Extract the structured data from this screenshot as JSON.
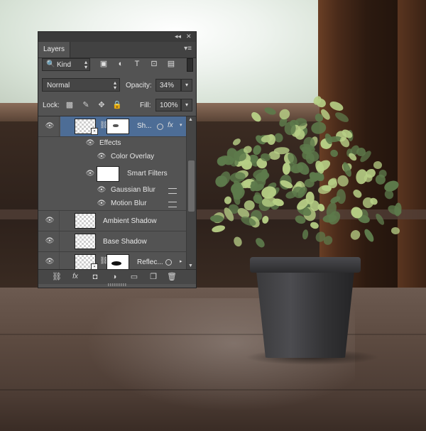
{
  "panel": {
    "tab_title": "Layers",
    "filter_kind": "Kind",
    "blend_mode": "Normal",
    "opacity_label": "Opacity:",
    "opacity_value": "34%",
    "lock_label": "Lock:",
    "fill_label": "Fill:",
    "fill_value": "100%"
  },
  "icons": {
    "search": "🔍",
    "image": "▣",
    "adjust": "◐",
    "type": "T",
    "transform": "⊡",
    "smart": "▤",
    "lock_pixels": "▩",
    "lock_paint": "✎",
    "lock_move": "✥",
    "lock_all": "🔒",
    "eye": "👁",
    "fx": "fx",
    "link": "⛓",
    "add_mask": "◘",
    "adjustment": "◑",
    "group": "▭",
    "new_layer": "❐",
    "trash": "🗑"
  },
  "layers": {
    "row1": {
      "name": "Sh...",
      "fx": "fx"
    },
    "effects_label": "Effects",
    "color_overlay": "Color Overlay",
    "smart_filters": "Smart Filters",
    "gaussian_blur": "Gaussian Blur",
    "motion_blur": "Motion Blur",
    "row_ambient": {
      "name": "Ambient Shadow"
    },
    "row_base": {
      "name": "Base Shadow"
    },
    "row_reflect": {
      "name": "Reflec..."
    }
  },
  "footer": {
    "link_icon": "⛓",
    "fx": "fx",
    "mask_icon": "◘",
    "adjust_icon": "◑",
    "group_icon": "▭",
    "new_icon": "❐",
    "trash_icon": "🗑"
  },
  "colors": {
    "panel_bg": "#535353",
    "selected_row": "#4d6d96",
    "leaf_light": "#b7cf86",
    "leaf_dark": "#5d7a4b"
  }
}
